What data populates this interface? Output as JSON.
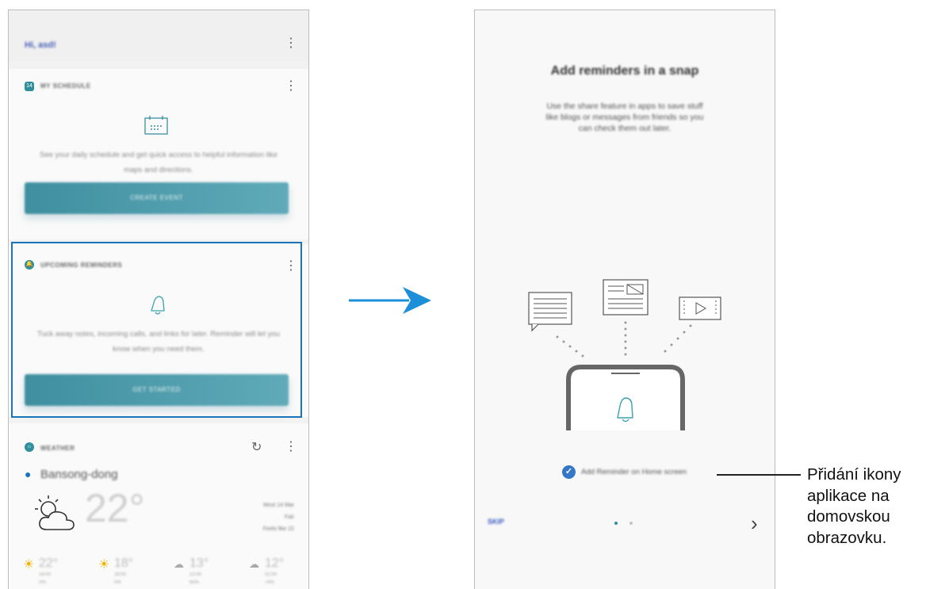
{
  "left_screen": {
    "greeting": "Hi, asd!",
    "cards": [
      {
        "title": "MY SCHEDULE",
        "icon": "calendar-icon",
        "description": "See your daily schedule and get quick access to helpful information like maps and directions.",
        "button": "CREATE EVENT"
      },
      {
        "title": "UPCOMING REMINDERS",
        "icon": "bell-icon",
        "description": "Tuck away notes, incoming calls, and links for later. Reminder will let you know when you need them.",
        "button": "GET STARTED"
      },
      {
        "title": "WEATHER",
        "location": "Bansong-dong",
        "temperature": "22°",
        "details": [
          "Most 14 Mar",
          "Fair",
          "Feels like 22"
        ],
        "forecast": [
          {
            "temp": "22°",
            "time": "14:00",
            "pct": "0%",
            "icon": "sun-icon"
          },
          {
            "temp": "18°",
            "time": "18:00",
            "pct": "0%",
            "icon": "sun-icon"
          },
          {
            "temp": "13°",
            "time": "22:00",
            "pct": "65%",
            "icon": "rain-cloud-icon"
          },
          {
            "temp": "12°",
            "time": "02:00",
            "pct": "74%",
            "icon": "rain-cloud-icon"
          }
        ]
      }
    ]
  },
  "right_screen": {
    "title": "Add reminders in a snap",
    "description": "Use the share feature in apps to save stuff like blogs or messages from friends so you can check them out later.",
    "checkbox_label": "Add Reminder on Home screen",
    "checkbox_checked": true,
    "skip": "SKIP",
    "next": "›"
  },
  "callout": {
    "line1": "Přidání ikony",
    "line2": "aplikace na",
    "line3": "domovskou",
    "line4": "obrazovku."
  },
  "colors": {
    "accent": "#1b73b8",
    "teal": "#2f8f9a",
    "arrow": "#1b8fd8"
  }
}
